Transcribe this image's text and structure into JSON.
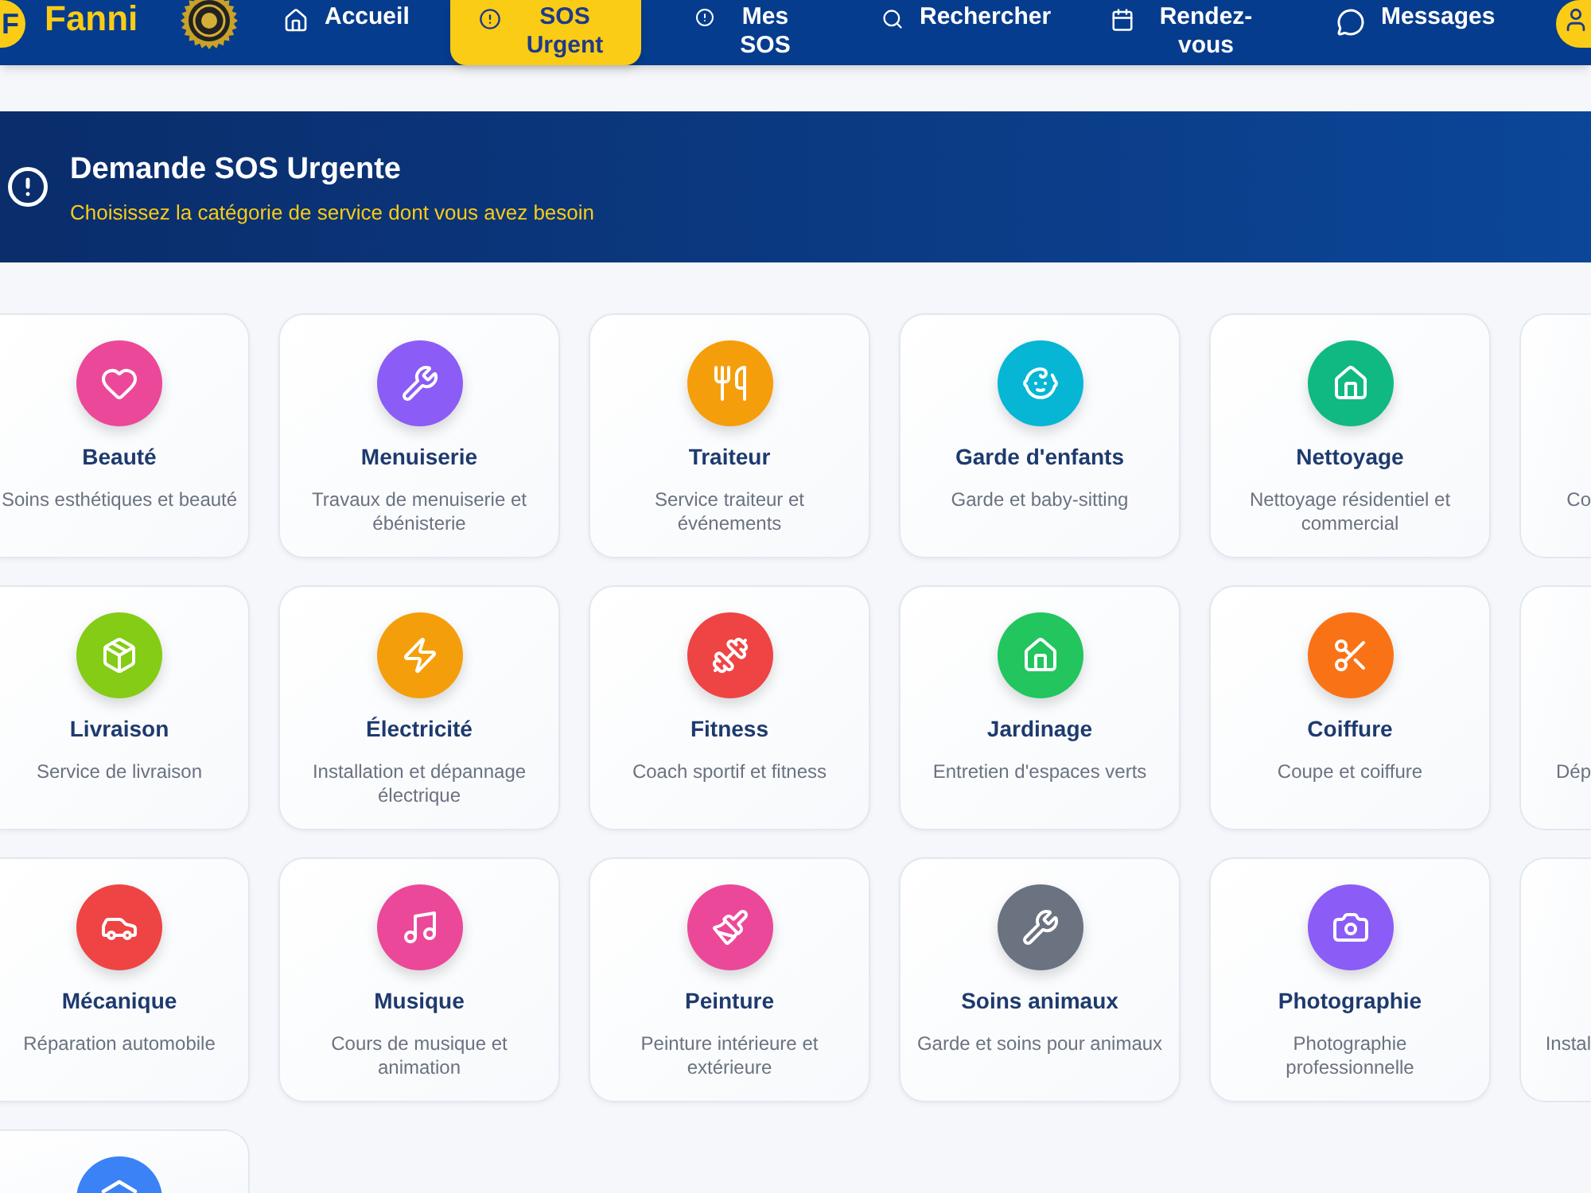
{
  "header": {
    "logo_letter": "F",
    "brand": "Fanni",
    "nav": [
      {
        "label": "Accueil",
        "selected": false
      },
      {
        "label": "SOS Urgent",
        "selected": true
      },
      {
        "label": "Mes SOS",
        "selected": false
      },
      {
        "label": "Rechercher",
        "selected": false
      },
      {
        "label": "Rendez-vous",
        "selected": false
      },
      {
        "label": "Messages",
        "selected": false
      }
    ]
  },
  "banner": {
    "title": "Demande SOS Urgente",
    "subtitle": "Choisissez la catégorie de service dont vous avez besoin"
  },
  "categories": [
    {
      "title": "Beauté",
      "description": "Soins esthétiques et beauté",
      "color": "#ec4899"
    },
    {
      "title": "Menuiserie",
      "description": "Travaux de menuiserie et ébénisterie",
      "color": "#8b5cf6"
    },
    {
      "title": "Traiteur",
      "description": "Service traiteur et événements",
      "color": "#f59e0b"
    },
    {
      "title": "Garde d'enfants",
      "description": "Garde et baby-sitting",
      "color": "#06b6d4"
    },
    {
      "title": "Nettoyage",
      "description": "Nettoyage résidentiel et commercial",
      "color": "#10b981"
    },
    {
      "description": "Co"
    },
    {
      "title": "Livraison",
      "description": "Service de livraison",
      "color": "#84cc16"
    },
    {
      "title": "Électricité",
      "description": "Installation et dépannage électrique",
      "color": "#f59e0b"
    },
    {
      "title": "Fitness",
      "description": "Coach sportif et fitness",
      "color": "#ef4444"
    },
    {
      "title": "Jardinage",
      "description": "Entretien d'espaces verts",
      "color": "#22c55e"
    },
    {
      "title": "Coiffure",
      "description": "Coupe et coiffure",
      "color": "#f97316"
    },
    {
      "description": "Dép"
    },
    {
      "title": "Mécanique",
      "description": "Réparation automobile",
      "color": "#ef4444"
    },
    {
      "title": "Musique",
      "description": "Cours de musique et animation",
      "color": "#ec4899"
    },
    {
      "title": "Peinture",
      "description": "Peinture intérieure et extérieure",
      "color": "#ec4899"
    },
    {
      "title": "Soins animaux",
      "description": "Garde et soins pour animaux",
      "color": "#6b7280"
    },
    {
      "title": "Photographie",
      "description": "Photographie professionnelle",
      "color": "#8b5cf6"
    },
    {
      "description": "Instal"
    },
    {
      "color": "#3b82f6"
    }
  ]
}
